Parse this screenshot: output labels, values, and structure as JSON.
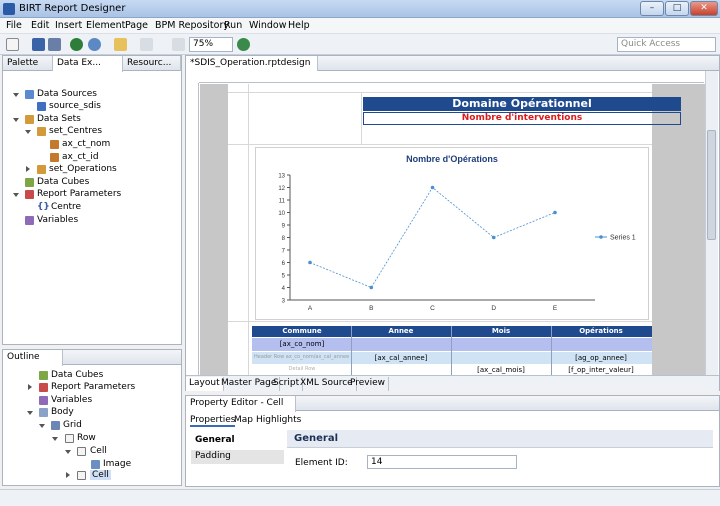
{
  "window": {
    "title": "BIRT Report Designer",
    "minimize": "–",
    "maximize": "□",
    "close": "✕"
  },
  "menu": [
    "File",
    "Edit",
    "Insert",
    "Element",
    "Page",
    "BPM Repository",
    "Run",
    "Window",
    "Help"
  ],
  "toolbar": {
    "zoom": "75%",
    "quick_access_placeholder": "Quick Access"
  },
  "left_tabs": [
    "Palette",
    "Data Ex...",
    "Resourc..."
  ],
  "data_explorer": {
    "data_sources": "Data Sources",
    "source": "source_sdis",
    "data_sets": "Data Sets",
    "set_centres": "set_Centres",
    "col1": "ax_ct_nom",
    "col2": "ax_ct_id",
    "set_operations": "set_Operations",
    "data_cubes": "Data Cubes",
    "report_parameters": "Report Parameters",
    "param_centre": "Centre",
    "variables": "Variables"
  },
  "outline": {
    "title": "Outline",
    "data_cubes": "Data Cubes",
    "report_parameters": "Report Parameters",
    "variables": "Variables",
    "body": "Body",
    "grid": "Grid",
    "row": "Row",
    "cell1": "Cell",
    "image": "Image",
    "cell2": "Cell"
  },
  "editor": {
    "tab_label": "*SDIS_Operation.rptdesign",
    "report_title": "Domaine Opérationnel",
    "report_subtitle": "Nombre d'interventions",
    "bottom_tabs": [
      "Layout",
      "Master Page",
      "Script",
      "XML Source",
      "Preview"
    ],
    "table_headers": [
      "Commune",
      "Annee",
      "Mois",
      "Opérations"
    ],
    "row1": {
      "commune": "[ax_co_nom]"
    },
    "row2": {
      "left": "Header Row ax_co_nom/ax_cal_annee",
      "annee": "[ax_cal_annee]",
      "ops": "[ag_op_annee]"
    },
    "row3": {
      "left": "Detail Row",
      "mois": "[ax_cal_mois]",
      "ops": "[f_op_inter_valeur]"
    }
  },
  "chart_data": {
    "type": "line",
    "title": "Nombre d'Opérations",
    "categories": [
      "A",
      "B",
      "C",
      "D",
      "E"
    ],
    "series": [
      {
        "name": "Series 1",
        "values": [
          6,
          4,
          12,
          8,
          10
        ]
      }
    ],
    "ylim": [
      3,
      13
    ],
    "yticks": [
      3,
      4,
      5,
      6,
      7,
      8,
      9,
      10,
      11,
      12,
      13
    ],
    "legend": "right",
    "color": "#4a90d0"
  },
  "properties": {
    "panel_title": "Property Editor - Cell",
    "tabs": [
      "Properties",
      "Map",
      "Highlights"
    ],
    "categories": [
      "General",
      "Padding"
    ],
    "section": "General",
    "element_id_label": "Element ID:",
    "element_id_value": "14"
  }
}
